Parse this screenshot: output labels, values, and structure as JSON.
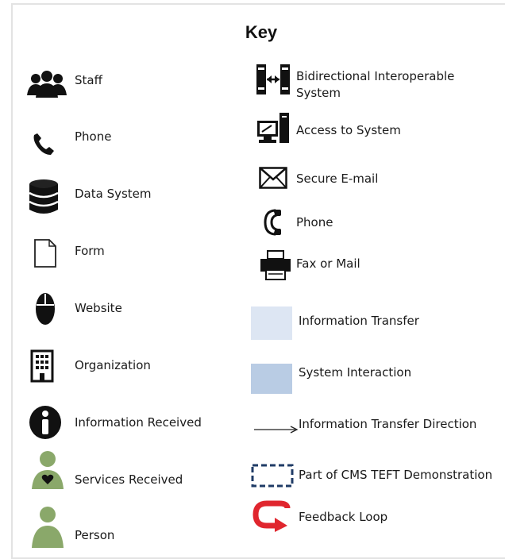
{
  "key": {
    "title": "Key",
    "left_items": [
      {
        "label": "Staff",
        "icon": "staff-icon"
      },
      {
        "label": "Phone",
        "icon": "phone-icon"
      },
      {
        "label": "Data System",
        "icon": "data-system-icon"
      },
      {
        "label": "Form",
        "icon": "form-icon"
      },
      {
        "label": "Website",
        "icon": "website-icon"
      },
      {
        "label": "Organization",
        "icon": "organization-icon"
      },
      {
        "label": "Information Received",
        "icon": "information-received-icon"
      },
      {
        "label": "Services Received",
        "icon": "services-received-icon"
      },
      {
        "label": "Person",
        "icon": "person-icon"
      }
    ],
    "right_items": [
      {
        "label_line1": "Bidirectional Interoperable",
        "label_line2": "System",
        "icon": "bidirectional-system-icon"
      },
      {
        "label": "Access to System",
        "icon": "access-to-system-icon"
      },
      {
        "label": "Secure E-mail",
        "icon": "secure-email-icon"
      },
      {
        "label": "Phone",
        "icon": "phone-handset-icon"
      },
      {
        "label": "Fax or Mail",
        "icon": "fax-icon"
      },
      {
        "label": "Information Transfer",
        "icon": "information-transfer-swatch",
        "color": "#dde6f3"
      },
      {
        "label": "System Interaction",
        "icon": "system-interaction-swatch",
        "color": "#b9cce4"
      },
      {
        "label": "Information Transfer Direction",
        "icon": "arrow-icon"
      },
      {
        "label": "Part of CMS TEFT Demonstration",
        "icon": "dashed-box-icon",
        "color": "#1f3b66"
      },
      {
        "label": "Feedback Loop",
        "icon": "feedback-loop-icon",
        "color": "#e0262e"
      }
    ]
  }
}
